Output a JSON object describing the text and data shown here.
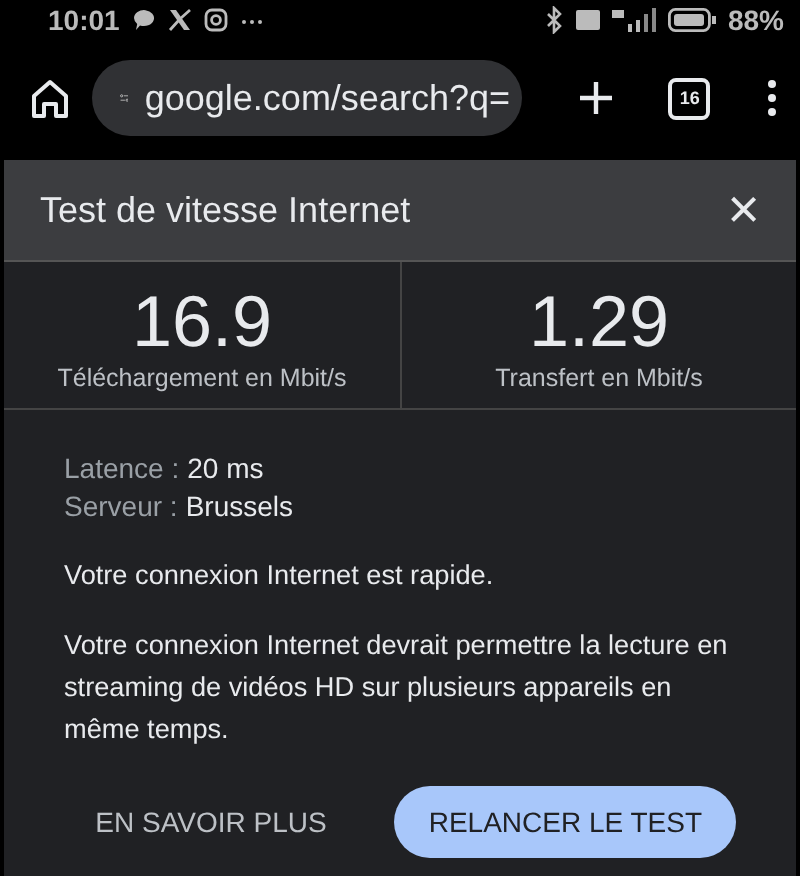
{
  "status_bar": {
    "time": "10:01",
    "battery": "88%"
  },
  "browser": {
    "url": "google.com/search?q=",
    "tab_count": "16"
  },
  "dialog": {
    "title": "Test de vitesse Internet",
    "close": "×",
    "metrics": [
      {
        "value": "16.9",
        "label": "Téléchargement en Mbit/s"
      },
      {
        "value": "1.29",
        "label": "Transfert en Mbit/s"
      }
    ],
    "details": [
      {
        "label": "Latence :",
        "value": "20 ms"
      },
      {
        "label": "Serveur :",
        "value": "Brussels"
      }
    ],
    "paragraphs": [
      "Votre connexion Internet est rapide.",
      "Votre connexion Internet devrait permettre la lecture en streaming de vidéos HD sur plusieurs appareils en même temps."
    ],
    "buttons": [
      {
        "label": "EN SAVOIR PLUS",
        "kind": "text"
      },
      {
        "label": "RELANCER LE TEST",
        "kind": "filled"
      }
    ]
  }
}
